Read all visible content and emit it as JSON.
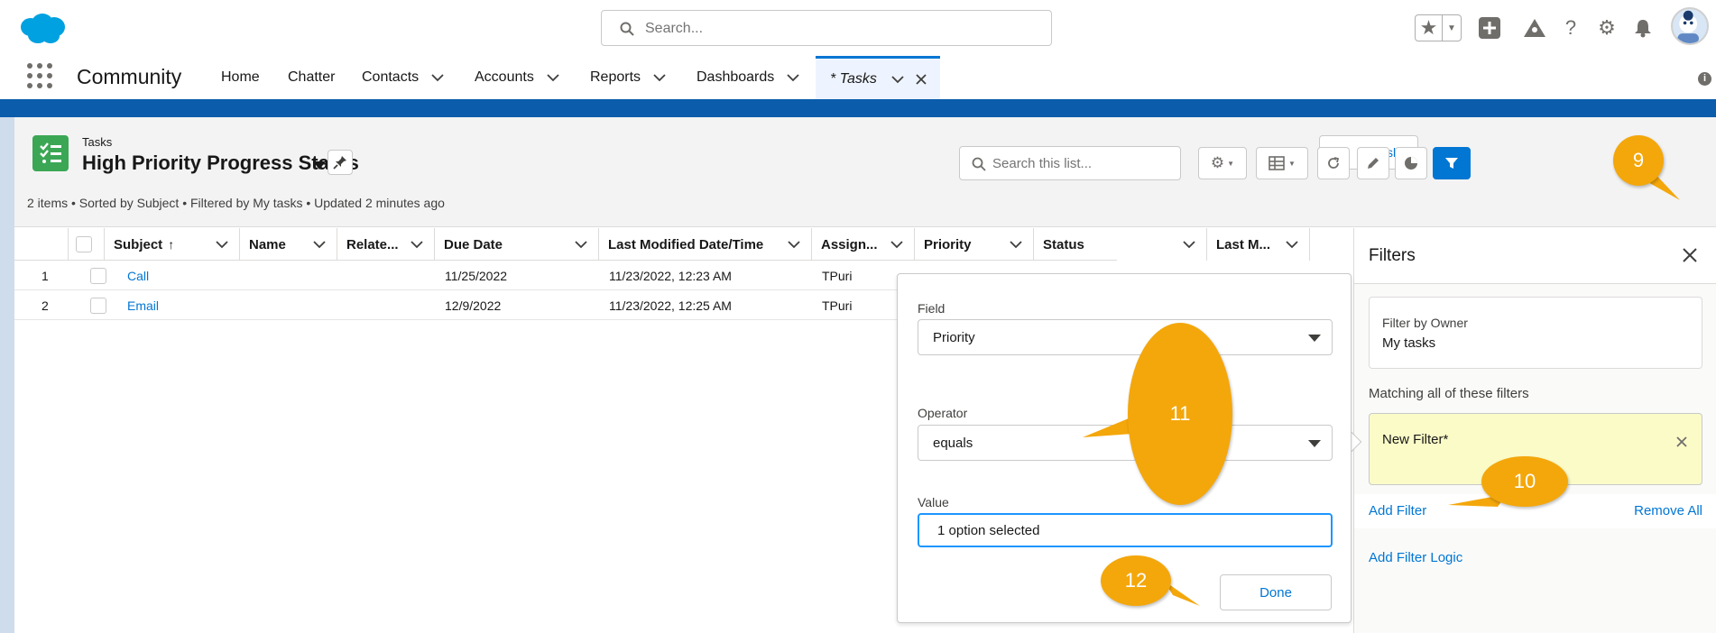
{
  "header": {
    "search_placeholder": "Search..."
  },
  "nav": {
    "app_name": "Community",
    "items": [
      {
        "label": "Home"
      },
      {
        "label": "Chatter"
      },
      {
        "label": "Contacts"
      },
      {
        "label": "Accounts"
      },
      {
        "label": "Reports"
      },
      {
        "label": "Dashboards"
      }
    ],
    "active_tab": "* Tasks"
  },
  "list": {
    "object_label": "Tasks",
    "title": "High Priority Progress Status",
    "meta": "2 items • Sorted by Subject • Filtered by My tasks • Updated 2 minutes ago",
    "new_button_label": "sk",
    "search_placeholder": "Search this list..."
  },
  "table": {
    "columns": [
      "Subject",
      "Name",
      "Relate...",
      "Due Date",
      "Last Modified Date/Time",
      "Assign...",
      "Priority",
      "Status",
      "Last M..."
    ],
    "sort_indicator": "↑",
    "rows": [
      {
        "num": "1",
        "subject": "Call",
        "due_date": "11/25/2022",
        "last_modified": "11/23/2022, 12:23 AM",
        "assigned": "TPuri"
      },
      {
        "num": "2",
        "subject": "Email",
        "due_date": "12/9/2022",
        "last_modified": "11/23/2022, 12:25 AM",
        "assigned": "TPuri"
      }
    ]
  },
  "popover": {
    "field_label": "Field",
    "field_value": "Priority",
    "operator_label": "Operator",
    "operator_value": "equals",
    "value_label": "Value",
    "value_value": "1 option selected",
    "done_label": "Done"
  },
  "filters_panel": {
    "title": "Filters",
    "owner_label": "Filter by Owner",
    "owner_value": "My tasks",
    "matching_label": "Matching all of these filters",
    "new_filter_label": "New Filter*",
    "add_filter": "Add Filter",
    "remove_all": "Remove All",
    "add_filter_logic": "Add Filter Logic"
  },
  "callouts": [
    "9",
    "10",
    "11",
    "12"
  ],
  "colors": {
    "brand_blue": "#0176d3",
    "band_blue": "#0b5cab",
    "task_green": "#3ba755",
    "callout_orange": "#f4a70b",
    "new_filter_bg": "#fbfbc8"
  }
}
